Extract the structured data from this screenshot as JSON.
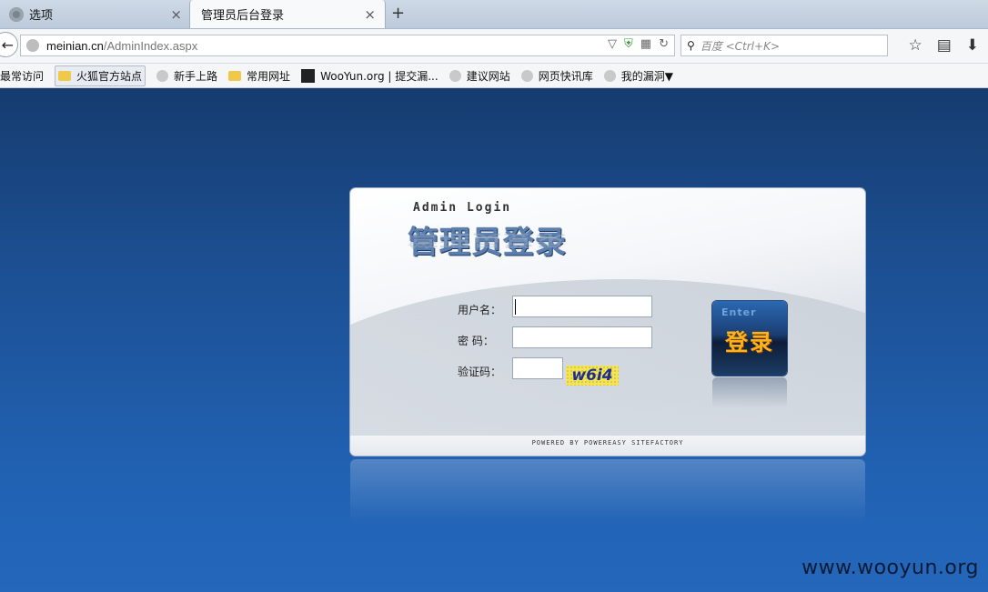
{
  "tabs": [
    {
      "label": "选项",
      "active": false
    },
    {
      "label": "管理员后台登录",
      "active": true
    }
  ],
  "newtab_symbol": "+",
  "address": {
    "domain": "meinian.cn",
    "path": "/AdminIndex.aspx"
  },
  "search": {
    "placeholder": "百度 <Ctrl+K>"
  },
  "bookmarks": [
    "最常访问",
    "火狐官方站点",
    "新手上路",
    "常用网址",
    "WooYun.org | 提交漏...",
    "建议网站",
    "网页快讯库",
    "我的漏洞▼"
  ],
  "login": {
    "title_en": "Admin Login",
    "title_cn": "管理员登录",
    "username_label": "用户名：",
    "password_label": "密 码：",
    "captcha_label": "验证码：",
    "captcha_text": "w6i4",
    "enter_en": "Enter",
    "enter_cn": "登录",
    "powered": "POWERED BY POWEREASY SITEFACTORY"
  },
  "watermark": "www.wooyun.org",
  "colors": {
    "page_bg": "#1c4f92",
    "button_gold": "#ffb21a",
    "captcha_bg": "#f2e45b"
  }
}
